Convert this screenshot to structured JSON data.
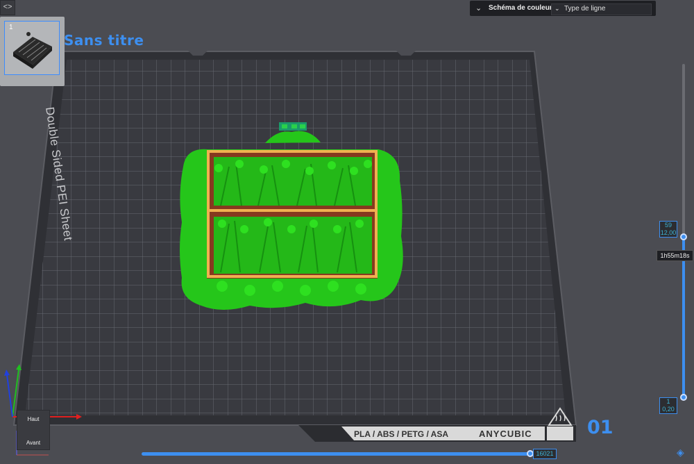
{
  "sidebar": {
    "collapse_symbol": "<>",
    "plate_index": "1"
  },
  "plate": {
    "title": "Sans titre",
    "sheet_label": "Double Sided PEI Sheet",
    "filament_label": "PLA / ABS / PETG / ASA",
    "brand_label": "ANYCUBIC",
    "number": "01"
  },
  "color_scheme": {
    "label": "Schéma de couleur",
    "selected": "Type de ligne"
  },
  "layer_slider": {
    "top_layer": "59",
    "top_height": "12,00",
    "bottom_layer": "1",
    "bottom_height": "0,20",
    "print_time": "1h55m18s"
  },
  "move_slider": {
    "value": "16021"
  },
  "view_cube": {
    "top_label": "Haut",
    "front_label": "Avant"
  },
  "icons": {
    "collapse": "collapse-sidebar-icon",
    "scheme": "chevron-double-icon",
    "dropdown": "chevron-down-icon",
    "layers": "layers-icon",
    "heatbed": "heated-bed-icon"
  },
  "colors": {
    "accent": "#3d8ff0",
    "background": "#4b4c52",
    "plate": "#35363b",
    "model_green": "#22c414",
    "outline_orange": "#e4a441",
    "infill_brown": "#7a3a28"
  }
}
